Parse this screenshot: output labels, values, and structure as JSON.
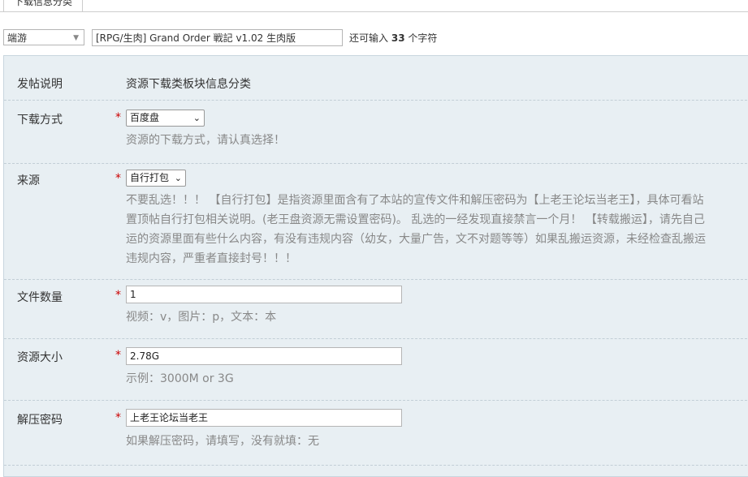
{
  "tab": {
    "label": "下载信息分类"
  },
  "top": {
    "category": "端游",
    "title_value": "[RPG/生肉] Grand Order 戦記 v1.02 生肉版",
    "remain_prefix": "还可输入",
    "remain_count": "33",
    "remain_suffix": "个字符"
  },
  "form": {
    "notice": {
      "label": "发帖说明",
      "value": "资源下载类板块信息分类"
    },
    "download_method": {
      "label": "下载方式",
      "star": "*",
      "selected": "百度盘",
      "hint": "资源的下载方式，请认真选择！"
    },
    "source": {
      "label": "来源",
      "star": "*",
      "selected": "自行打包",
      "hint_lines": [
        "不要乱选！！！ 【自行打包】是指资源里面含有了本站的宣传文件和解压密码为【上老王论坛当老王】，具体可看站",
        "置顶帖自行打包相关说明。(老王盘资源无需设置密码)。 乱选的一经发现直接禁言一个月！ 【转载搬运】，请先自己",
        "运的资源里面有些什么内容，有没有违规内容（幼女，大量广告，文不对题等等）如果乱搬运资源，未经检查乱搬运",
        "违规内容，严重者直接封号！！！"
      ]
    },
    "file_count": {
      "label": "文件数量",
      "star": "*",
      "value": "1",
      "hint": "视频：v，图片：p，文本：本"
    },
    "size": {
      "label": "资源大小",
      "star": "*",
      "value": "2.78G",
      "hint": "示例：3000M or 3G"
    },
    "password": {
      "label": "解压密码",
      "star": "*",
      "value": "上老王论坛当老王",
      "hint": "如果解压密码，请填写，没有就填：无"
    }
  },
  "colors": {
    "panel_bg": "#e8eff3",
    "required_star": "#cc0000",
    "hint_text": "#888888"
  }
}
